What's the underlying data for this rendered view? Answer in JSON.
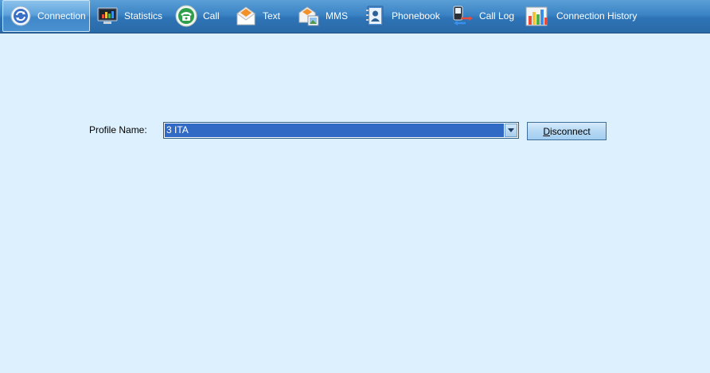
{
  "toolbar": {
    "tabs": [
      {
        "label": "Connection",
        "icon": "connection-refresh-icon",
        "active": true
      },
      {
        "label": "Statistics",
        "icon": "statistics-monitor-icon",
        "active": false
      },
      {
        "label": "Call",
        "icon": "phone-icon",
        "active": false
      },
      {
        "label": "Text",
        "icon": "envelope-icon",
        "active": false
      },
      {
        "label": "MMS",
        "icon": "mms-envelope-icon",
        "active": false
      },
      {
        "label": "Phonebook",
        "icon": "phonebook-icon",
        "active": false
      },
      {
        "label": "Call Log",
        "icon": "call-log-icon",
        "active": false
      },
      {
        "label": "Connection History",
        "icon": "connection-history-icon",
        "active": false
      }
    ]
  },
  "connection": {
    "profile_label": "Profile Name:",
    "profile_value": "3 ITA",
    "disconnect_mnemonic": "D",
    "disconnect_rest": "isconnect"
  },
  "colors": {
    "toolbar_bg": "#3a83c4",
    "page_bg": "#ddf0fd",
    "selection": "#316ac5"
  }
}
